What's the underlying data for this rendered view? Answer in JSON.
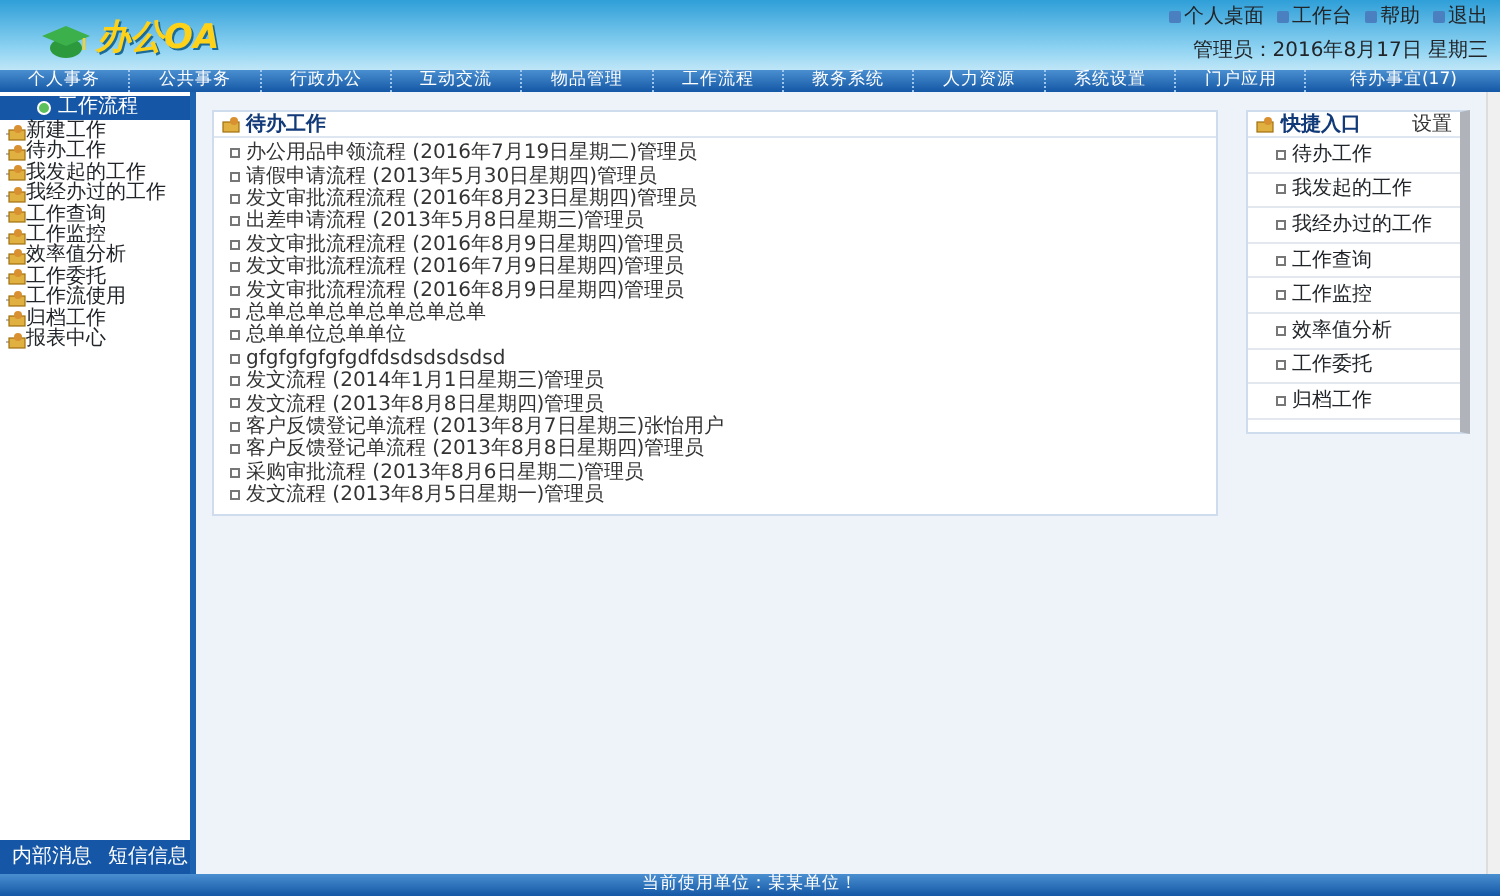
{
  "header": {
    "logo": "办公OA",
    "links": [
      "个人桌面",
      "工作台",
      "帮助",
      "退出"
    ],
    "user_line": "管理员：2016年8月17日 星期三"
  },
  "nav": [
    "个人事务",
    "公共事务",
    "行政办公",
    "互动交流",
    "物品管理",
    "工作流程",
    "教务系统",
    "人力资源",
    "系统设置",
    "门户应用",
    "待办事宜(17)"
  ],
  "sidebar": {
    "title": "工作流程",
    "items": [
      "新建工作",
      "待办工作",
      "我发起的工作",
      "我经办过的工作",
      "工作查询",
      "工作监控",
      "效率值分析",
      "工作委托",
      "工作流使用",
      "归档工作",
      "报表中心"
    ],
    "bottom_tabs": [
      "内部消息",
      "短信信息"
    ]
  },
  "todo": {
    "title": "待办工作",
    "items": [
      "办公用品申领流程 (2016年7月19日星期二)管理员",
      "请假申请流程 (2013年5月30日星期四)管理员",
      "发文审批流程流程 (2016年8月23日星期四)管理员",
      "出差申请流程 (2013年5月8日星期三)管理员",
      "发文审批流程流程 (2016年8月9日星期四)管理员",
      "发文审批流程流程 (2016年7月9日星期四)管理员",
      "发文审批流程流程 (2016年8月9日星期四)管理员",
      "总单总单总单总单总单总单",
      "总单单位总单单位",
      "gfgfgfgfgfgdfdsdsdsdsdsd",
      "发文流程 (2014年1月1日星期三)管理员",
      "发文流程 (2013年8月8日星期四)管理员",
      "客户反馈登记单流程 (2013年8月7日星期三)张怡用户",
      "客户反馈登记单流程 (2013年8月8日星期四)管理员",
      "采购审批流程 (2013年8月6日星期二)管理员",
      "发文流程 (2013年8月5日星期一)管理员"
    ]
  },
  "shortcuts": {
    "title": "快捷入口",
    "action": "设置",
    "items": [
      "待办工作",
      "我发起的工作",
      "我经办过的工作",
      "工作查询",
      "工作监控",
      "效率值分析",
      "工作委托",
      "归档工作"
    ]
  },
  "status_bar": "当前使用单位：某某单位！"
}
